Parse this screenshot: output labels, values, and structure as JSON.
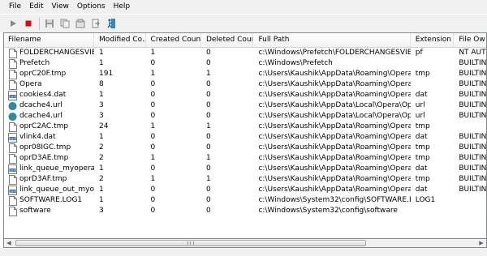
{
  "menu": [
    {
      "label": "File",
      "name": "menu-file"
    },
    {
      "label": "Edit",
      "name": "menu-edit"
    },
    {
      "label": "View",
      "name": "menu-view"
    },
    {
      "label": "Options",
      "name": "menu-options"
    },
    {
      "label": "Help",
      "name": "menu-help"
    }
  ],
  "toolbar": {
    "buttons": [
      "play-icon",
      "stop-icon",
      "save-icon",
      "copy-icon",
      "properties-icon",
      "refresh-icon",
      "exit-icon"
    ]
  },
  "columns": [
    "Filename",
    "Modified Co...",
    "Created Count",
    "Deleted Count",
    "Full Path",
    "Extension",
    "File Ow"
  ],
  "rows": [
    {
      "icon": "file-icon",
      "name": "FOLDERCHANGESVIE...",
      "mod": "1",
      "cre": "1",
      "del": "0",
      "path": "c:\\Windows\\Prefetch\\FOLDERCHANGESVIEW....",
      "ext": "pf",
      "owner": "NT AUT"
    },
    {
      "icon": "file-icon",
      "name": "Prefetch",
      "mod": "1",
      "cre": "0",
      "del": "0",
      "path": "c:\\Windows\\Prefetch",
      "ext": "",
      "owner": "BUILTIN"
    },
    {
      "icon": "file-icon",
      "name": "oprC20F.tmp",
      "mod": "191",
      "cre": "1",
      "del": "1",
      "path": "c:\\Users\\Kaushik\\AppData\\Roaming\\Opera\\O...",
      "ext": "tmp",
      "owner": "BUILTIN"
    },
    {
      "icon": "file-icon",
      "name": "Opera",
      "mod": "8",
      "cre": "0",
      "del": "0",
      "path": "c:\\Users\\Kaushik\\AppData\\Roaming\\Opera\\O...",
      "ext": "",
      "owner": "BUILTIN"
    },
    {
      "icon": "settings-file-icon",
      "name": "cookies4.dat",
      "mod": "1",
      "cre": "0",
      "del": "0",
      "path": "c:\\Users\\Kaushik\\AppData\\Roaming\\Opera\\O...",
      "ext": "dat",
      "owner": "BUILTIN"
    },
    {
      "icon": "globe-icon",
      "name": "dcache4.url",
      "mod": "3",
      "cre": "0",
      "del": "0",
      "path": "c:\\Users\\Kaushik\\AppData\\Local\\Opera\\Oper...",
      "ext": "url",
      "owner": "BUILTIN"
    },
    {
      "icon": "globe-icon",
      "name": "dcache4.url",
      "mod": "3",
      "cre": "0",
      "del": "0",
      "path": "c:\\Users\\Kaushik\\AppData\\Local\\Opera\\Oper...",
      "ext": "url",
      "owner": "BUILTIN"
    },
    {
      "icon": "file-icon",
      "name": "oprC2AC.tmp",
      "mod": "24",
      "cre": "1",
      "del": "1",
      "path": "c:\\Users\\Kaushik\\AppData\\Roaming\\Opera\\O...",
      "ext": "tmp",
      "owner": ""
    },
    {
      "icon": "settings-file-icon",
      "name": "vlink4.dat",
      "mod": "1",
      "cre": "0",
      "del": "0",
      "path": "c:\\Users\\Kaushik\\AppData\\Roaming\\Opera\\O...",
      "ext": "dat",
      "owner": "BUILTIN"
    },
    {
      "icon": "file-icon",
      "name": "opr08IGC.tmp",
      "mod": "2",
      "cre": "0",
      "del": "0",
      "path": "c:\\Users\\Kaushik\\AppData\\Roaming\\Opera\\O...",
      "ext": "tmp",
      "owner": "BUILTIN"
    },
    {
      "icon": "file-icon",
      "name": "oprD3AE.tmp",
      "mod": "2",
      "cre": "1",
      "del": "1",
      "path": "c:\\Users\\Kaushik\\AppData\\Roaming\\Opera\\O...",
      "ext": "tmp",
      "owner": "BUILTIN"
    },
    {
      "icon": "settings-file-icon",
      "name": "link_queue_myopera....",
      "mod": "1",
      "cre": "0",
      "del": "0",
      "path": "c:\\Users\\Kaushik\\AppData\\Roaming\\Opera\\O...",
      "ext": "dat",
      "owner": "BUILTIN"
    },
    {
      "icon": "file-icon",
      "name": "oprD3AF.tmp",
      "mod": "2",
      "cre": "1",
      "del": "1",
      "path": "c:\\Users\\Kaushik\\AppData\\Roaming\\Opera\\O...",
      "ext": "tmp",
      "owner": "BUILTIN"
    },
    {
      "icon": "settings-file-icon",
      "name": "link_queue_out_myop...",
      "mod": "1",
      "cre": "0",
      "del": "0",
      "path": "c:\\Users\\Kaushik\\AppData\\Roaming\\Opera\\O...",
      "ext": "dat",
      "owner": "BUILTIN"
    },
    {
      "icon": "file-icon",
      "name": "SOFTWARE.LOG1",
      "mod": "1",
      "cre": "0",
      "del": "0",
      "path": "c:\\Windows\\System32\\config\\SOFTWARE.LOG1",
      "ext": "LOG1",
      "owner": ""
    },
    {
      "icon": "file-icon",
      "name": "software",
      "mod": "3",
      "cre": "0",
      "del": "0",
      "path": "c:\\Windows\\System32\\config\\software",
      "ext": "",
      "owner": ""
    }
  ],
  "scrollbar": {
    "grip": "|||"
  }
}
